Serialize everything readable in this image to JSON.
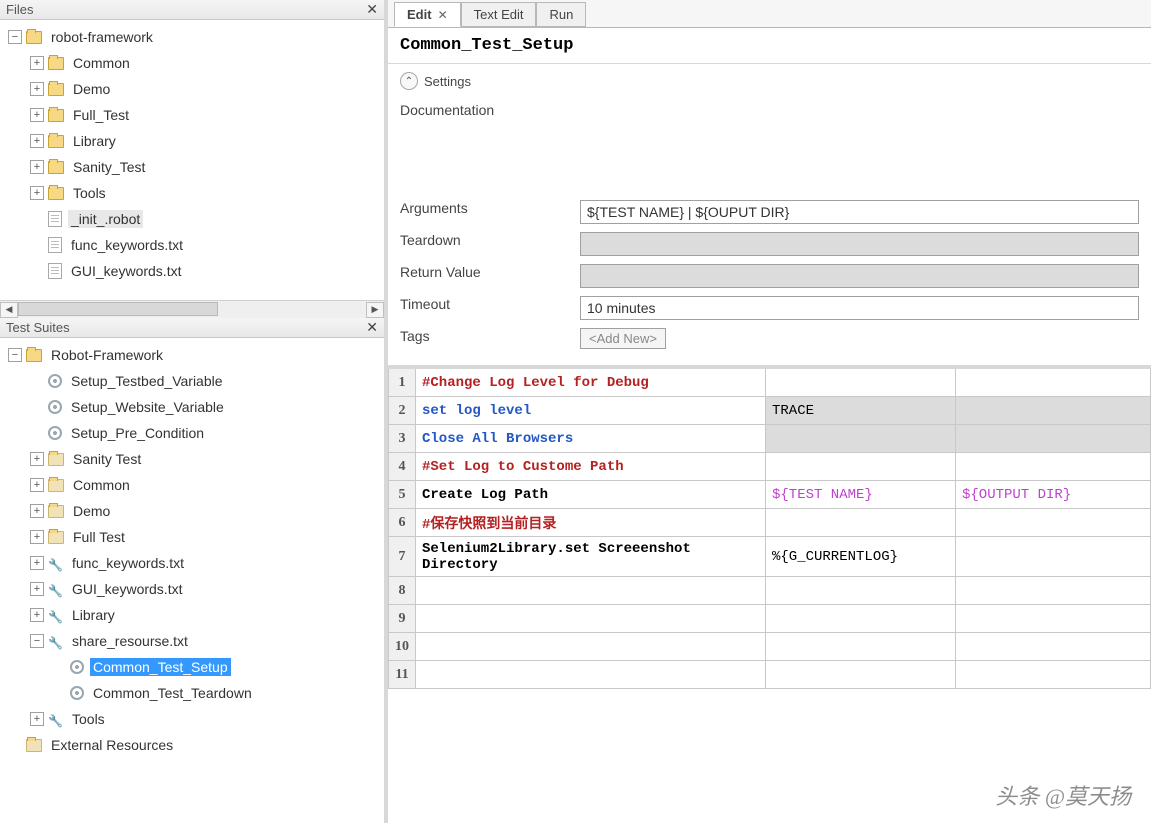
{
  "panels": {
    "files": {
      "title": "Files"
    },
    "test_suites": {
      "title": "Test Suites"
    }
  },
  "files_tree": {
    "root": "robot-framework",
    "children": [
      "Common",
      "Demo",
      "Full_Test",
      "Library",
      "Sanity_Test",
      "Tools"
    ],
    "files": [
      "_init_.robot",
      "func_keywords.txt",
      "GUI_keywords.txt"
    ]
  },
  "suites_tree": {
    "root": "Robot-Framework",
    "setup_items": [
      "Setup_Testbed_Variable",
      "Setup_Website_Variable",
      "Setup_Pre_Condition"
    ],
    "folders": [
      "Sanity Test",
      "Common",
      "Demo",
      "Full Test"
    ],
    "files": [
      "func_keywords.txt",
      "GUI_keywords.txt"
    ],
    "library": "Library",
    "share": "share_resourse.txt",
    "share_children": [
      "Common_Test_Setup",
      "Common_Test_Teardown"
    ],
    "tools": "Tools",
    "external": "External Resources"
  },
  "tabs": {
    "edit": "Edit",
    "text_edit": "Text Edit",
    "run": "Run"
  },
  "editor": {
    "title": "Common_Test_Setup",
    "settings_label": "Settings",
    "doc_label": "Documentation",
    "args_label": "Arguments",
    "args_value": "${TEST NAME} | ${OUPUT DIR}",
    "teardown_label": "Teardown",
    "return_label": "Return Value",
    "timeout_label": "Timeout",
    "timeout_value": "10 minutes",
    "tags_label": "Tags",
    "tags_placeholder": "<Add New>"
  },
  "grid_rows": [
    {
      "n": 1,
      "a": "#Change Log Level for Debug",
      "a_cls": "red",
      "b": "",
      "c": "",
      "shade": false
    },
    {
      "n": 2,
      "a": "set log level",
      "a_cls": "blue",
      "b": "TRACE",
      "c": "",
      "shade": true
    },
    {
      "n": 3,
      "a": "Close All Browsers",
      "a_cls": "blue",
      "b": "",
      "c": "",
      "shade": true
    },
    {
      "n": 4,
      "a": "#Set Log to Custome Path",
      "a_cls": "red",
      "b": "",
      "c": "",
      "shade": false
    },
    {
      "n": 5,
      "a": "Create Log Path",
      "a_cls": "blk",
      "b": "${TEST NAME}",
      "b_cls": "purple",
      "c": "${OUTPUT DIR}",
      "c_cls": "purple",
      "shade": false
    },
    {
      "n": 6,
      "a": "#保存快照到当前目录",
      "a_cls": "red",
      "b": "",
      "c": "",
      "shade": false
    },
    {
      "n": 7,
      "a": "Selenium2Library.set Screeenshot Directory",
      "a_cls": "blk",
      "b": "%{G_CURRENTLOG}",
      "c": "",
      "shade": false,
      "tall": true
    },
    {
      "n": 8,
      "a": "",
      "b": "",
      "c": "",
      "shade": false
    },
    {
      "n": 9,
      "a": "",
      "b": "",
      "c": "",
      "shade": false
    },
    {
      "n": 10,
      "a": "",
      "b": "",
      "c": "",
      "shade": false
    },
    {
      "n": 11,
      "a": "",
      "b": "",
      "c": "",
      "shade": false
    }
  ],
  "watermark": "头条 @莫天扬"
}
